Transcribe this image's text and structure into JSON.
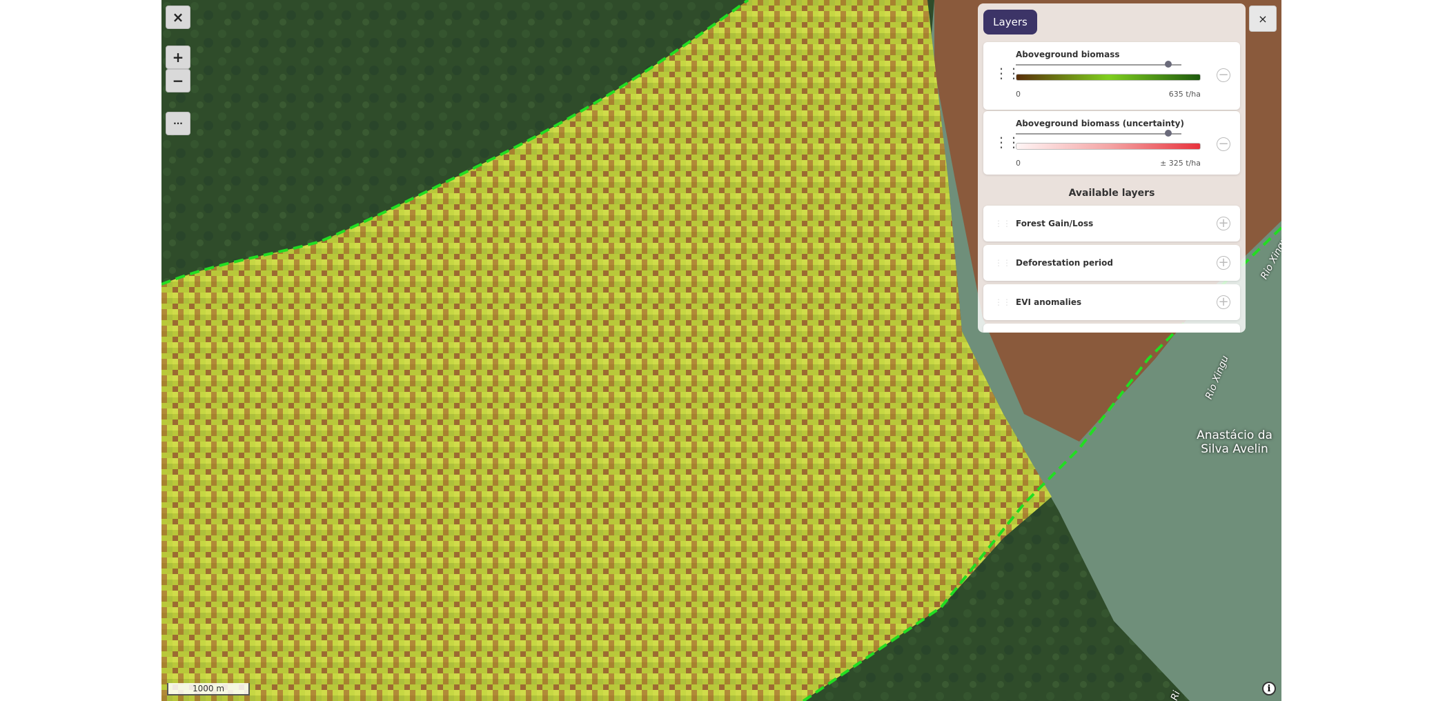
{
  "map": {
    "controls": {
      "close_glyph": "×",
      "zoom_in_glyph": "+",
      "zoom_out_glyph": "−",
      "more_glyph": "···"
    },
    "scale_bar": "1000 m",
    "info_glyph": "i",
    "labels": {
      "river_1": "Rio Xingu",
      "river_2": "Rio Xingu",
      "river_3": "Ri",
      "place": "Anastácio da Silva Avelin"
    },
    "boundary_color": "#22dd22"
  },
  "panel": {
    "tab_label": "Layers",
    "close_glyph": "×",
    "active_layers": [
      {
        "name": "Aboveground biomass",
        "opacity": 0.92,
        "legend_min": "0",
        "legend_max": "635 t/ha",
        "ramp_colors": [
          "#5a2f0a",
          "#7fcf1f",
          "#1e5a0e"
        ],
        "remove_glyph": "−"
      },
      {
        "name": "Aboveground biomass (uncertainty)",
        "opacity": 0.92,
        "legend_min": "0",
        "legend_max": "± 325 t/ha",
        "ramp_colors": [
          "#fff5f5",
          "#f4a6a6",
          "#e8333d"
        ],
        "remove_glyph": "−"
      }
    ],
    "available_title": "Available layers",
    "available_layers": [
      {
        "name": "Forest Gain/Loss",
        "add_glyph": "+"
      },
      {
        "name": "Deforestation period",
        "add_glyph": "+"
      },
      {
        "name": "EVI anomalies",
        "add_glyph": "+"
      }
    ]
  }
}
